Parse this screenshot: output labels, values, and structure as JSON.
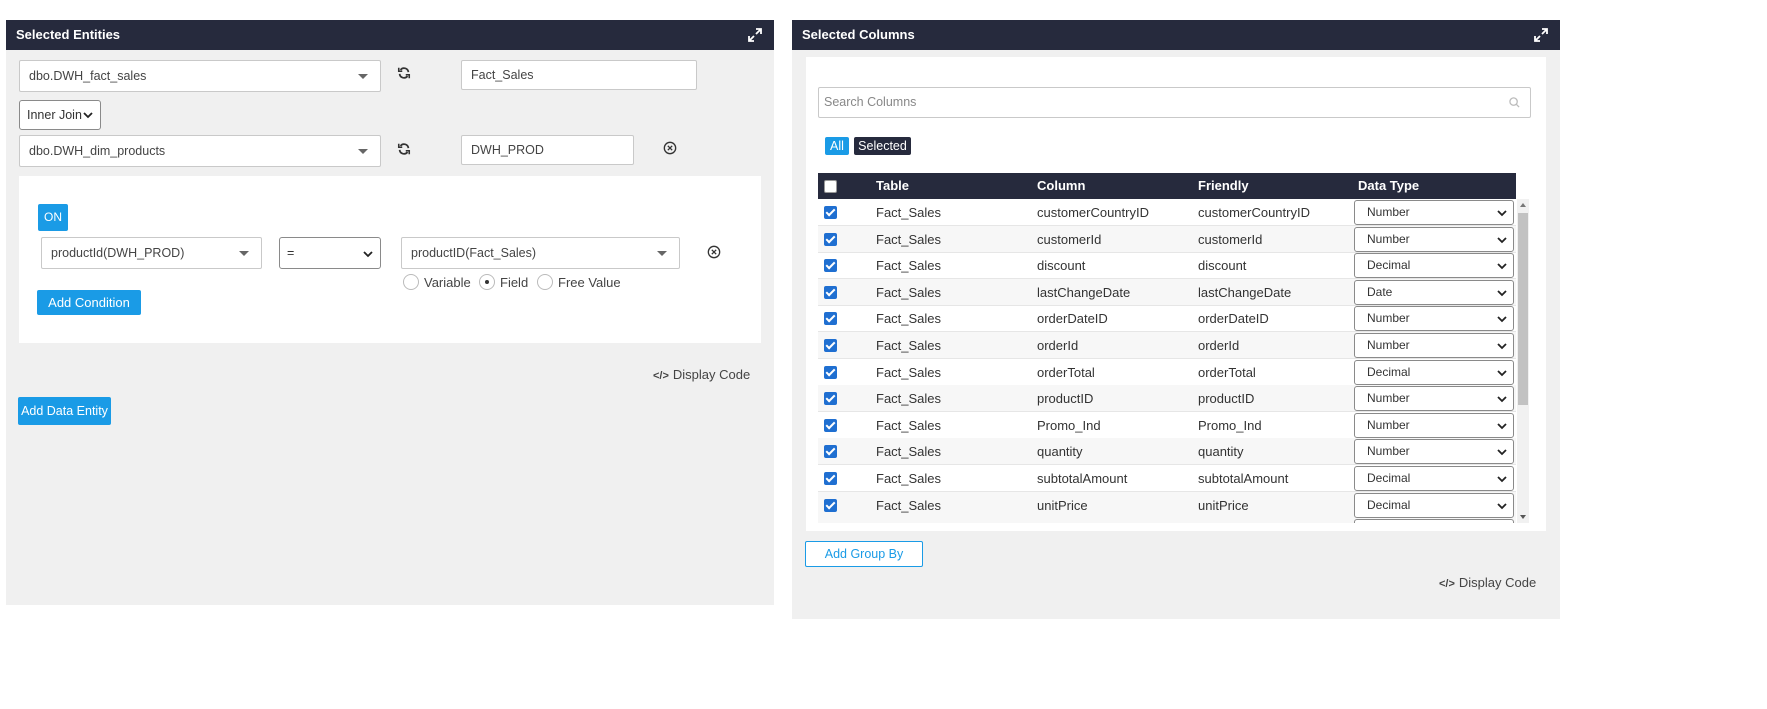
{
  "left_panel": {
    "title": "Selected Entities",
    "entity1": {
      "source": "dbo.DWH_fact_sales",
      "alias": "Fact_Sales"
    },
    "join_type": "Inner Join",
    "entity2": {
      "source": "dbo.DWH_dim_products",
      "alias": "DWH_PROD"
    },
    "condition": {
      "on_label": "ON",
      "left_field": "productId(DWH_PROD)",
      "operator": "=",
      "right_field": "productID(Fact_Sales)",
      "radio_options": [
        "Variable",
        "Field",
        "Free Value"
      ],
      "selected_radio": "Field",
      "add_condition_label": "Add Condition"
    },
    "display_code_label": "Display Code",
    "add_entity_label": "Add Data Entity"
  },
  "right_panel": {
    "title": "Selected Columns",
    "search_placeholder": "Search Columns",
    "filter_all": "All",
    "filter_selected": "Selected",
    "headers": [
      "Table",
      "Column",
      "Friendly",
      "Data Type"
    ],
    "rows": [
      {
        "table": "Fact_Sales",
        "column": "customerCountryID",
        "friendly": "customerCountryID",
        "type": "Number"
      },
      {
        "table": "Fact_Sales",
        "column": "customerId",
        "friendly": "customerId",
        "type": "Number"
      },
      {
        "table": "Fact_Sales",
        "column": "discount",
        "friendly": "discount",
        "type": "Decimal"
      },
      {
        "table": "Fact_Sales",
        "column": "lastChangeDate",
        "friendly": "lastChangeDate",
        "type": "Date"
      },
      {
        "table": "Fact_Sales",
        "column": "orderDateID",
        "friendly": "orderDateID",
        "type": "Number"
      },
      {
        "table": "Fact_Sales",
        "column": "orderId",
        "friendly": "orderId",
        "type": "Number"
      },
      {
        "table": "Fact_Sales",
        "column": "orderTotal",
        "friendly": "orderTotal",
        "type": "Decimal"
      },
      {
        "table": "Fact_Sales",
        "column": "productID",
        "friendly": "productID",
        "type": "Number"
      },
      {
        "table": "Fact_Sales",
        "column": "Promo_Ind",
        "friendly": "Promo_Ind",
        "type": "Number"
      },
      {
        "table": "Fact_Sales",
        "column": "quantity",
        "friendly": "quantity",
        "type": "Number"
      },
      {
        "table": "Fact_Sales",
        "column": "subtotalAmount",
        "friendly": "subtotalAmount",
        "type": "Decimal"
      },
      {
        "table": "Fact_Sales",
        "column": "unitPrice",
        "friendly": "unitPrice",
        "type": "Decimal"
      }
    ],
    "add_group_label": "Add Group By",
    "display_code_label": "Display Code"
  },
  "colors": {
    "header_bg": "#262a3d",
    "accent_blue": "#1a9be6",
    "panel_bg": "#f0f0f0"
  },
  "icons": [
    "expand-icon",
    "refresh-icon",
    "remove-icon",
    "search-icon",
    "code-icon",
    "chevron-down-icon"
  ]
}
